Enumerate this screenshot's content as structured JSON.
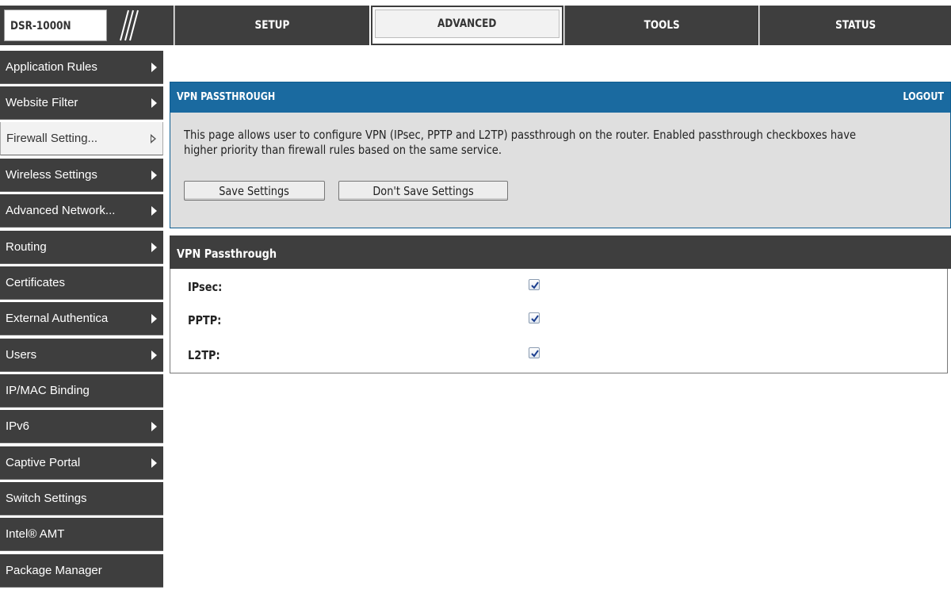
{
  "brand": {
    "model": "DSR-1000N"
  },
  "tabs": [
    {
      "label": "SETUP"
    },
    {
      "label": "ADVANCED"
    },
    {
      "label": "TOOLS"
    },
    {
      "label": "STATUS"
    }
  ],
  "sidebar": {
    "items": [
      {
        "label": "Application Rules"
      },
      {
        "label": "Website Filter"
      },
      {
        "label": "Firewall Setting..."
      },
      {
        "label": "Wireless Settings"
      },
      {
        "label": "Advanced Network..."
      },
      {
        "label": "Routing"
      },
      {
        "label": "Certificates"
      },
      {
        "label": "External Authentica"
      },
      {
        "label": "Users"
      },
      {
        "label": "IP/MAC Binding"
      },
      {
        "label": "IPv6"
      },
      {
        "label": "Captive Portal"
      },
      {
        "label": "Switch Settings"
      },
      {
        "label": "Intel® AMT"
      },
      {
        "label": "Package Manager"
      }
    ]
  },
  "panel": {
    "title": "VPN PASSTHROUGH",
    "logout": "LOGOUT",
    "description": "This page allows user to configure VPN (IPsec, PPTP and L2TP) passthrough on the router. Enabled passthrough checkboxes have higher priority than firewall rules based on the same service.",
    "save_label": "Save Settings",
    "dont_save_label": "Don't Save Settings"
  },
  "section": {
    "title": "VPN Passthrough",
    "rows": [
      {
        "label": "IPsec:",
        "checked": true
      },
      {
        "label": "PPTP:",
        "checked": true
      },
      {
        "label": "L2TP:",
        "checked": true
      }
    ]
  },
  "colors": {
    "nav_dark": "#3e3e3e",
    "header_blue": "#1a6aa0",
    "panel_gray": "#dfdfdf"
  }
}
